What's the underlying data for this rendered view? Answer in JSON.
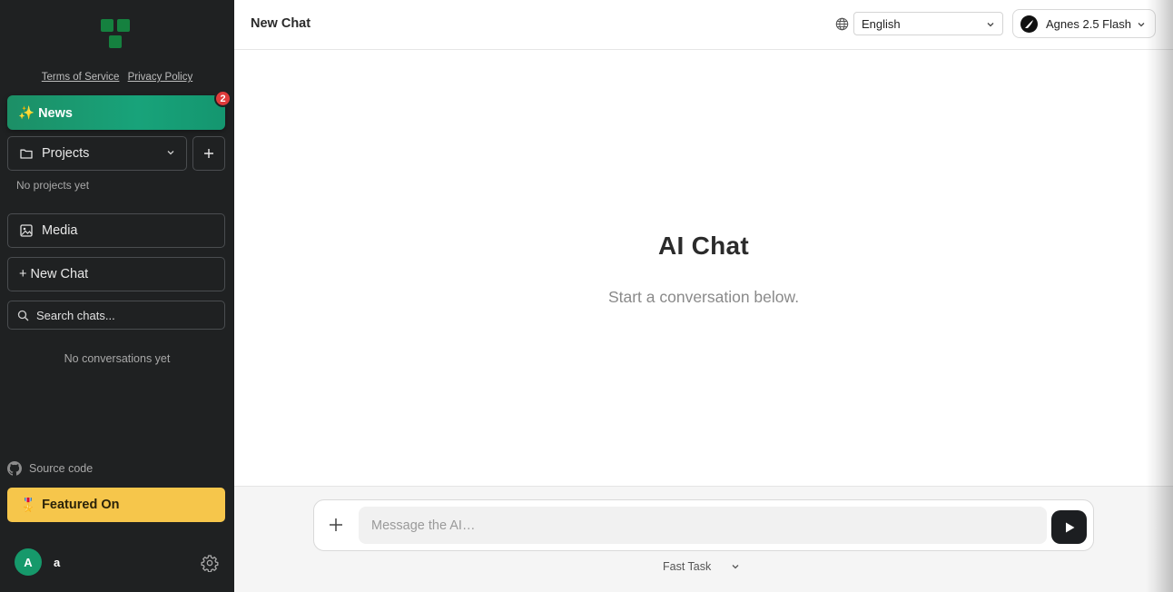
{
  "sidebar": {
    "links": {
      "terms": "Terms of Service",
      "privacy": "Privacy Policy"
    },
    "news": {
      "label": "✨ News",
      "badge_count": "2"
    },
    "projects": {
      "label": "Projects",
      "empty_text": "No projects yet"
    },
    "media_label": "Media",
    "new_chat_label": "+ New Chat",
    "search": {
      "placeholder": "Search chats..."
    },
    "empty_conversations": "No conversations yet",
    "source_code_label": "Source code",
    "featured_label": "Featured On",
    "featured_emoji": "🎖️",
    "user": {
      "initial": "A",
      "name": "a"
    }
  },
  "header": {
    "title": "New Chat",
    "language": "English",
    "model": "Agnes 2.5 Flash"
  },
  "main": {
    "title": "AI Chat",
    "subtitle": "Start a conversation below.",
    "composer": {
      "placeholder": "Message the AI…"
    },
    "mode_label": "Fast Task"
  },
  "colors": {
    "sidebar_bg": "#1f2122",
    "accent_green": "#18a37a",
    "badge_red": "#e03b3b",
    "featured_yellow": "#f6c64b",
    "send_button": "#1c1e21"
  }
}
